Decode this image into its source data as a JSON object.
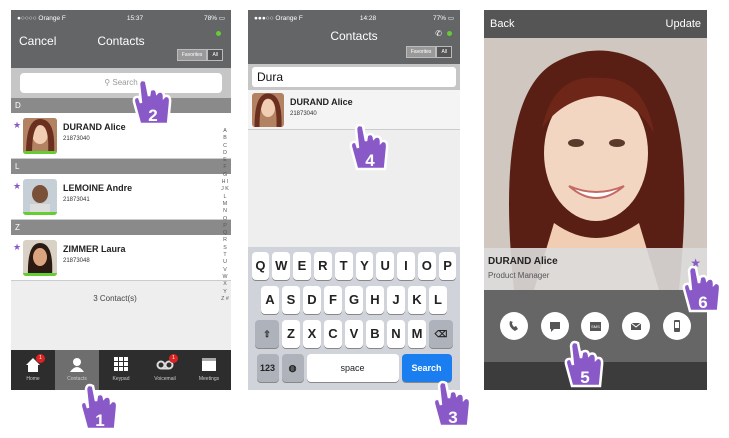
{
  "screen1": {
    "status": {
      "carrier": "●○○○○ Orange F",
      "time": "15:37",
      "battery": "78%"
    },
    "nav": {
      "cancel": "Cancel",
      "title": "Contacts",
      "seg_fav": "Favorites",
      "seg_all": "All"
    },
    "search_placeholder": "Search",
    "sections": [
      {
        "letter": "D",
        "contact": {
          "name": "DURAND Alice",
          "number": "21873040"
        }
      },
      {
        "letter": "L",
        "contact": {
          "name": "LEMOINE Andre",
          "number": "21873041"
        }
      },
      {
        "letter": "Z",
        "contact": {
          "name": "ZIMMER Laura",
          "number": "21873048"
        }
      }
    ],
    "index_letters": "A B C D E F G H I J K L M N O P Q R S T U V W X Y Z #",
    "count": "3 Contact(s)",
    "tabs": [
      {
        "label": "Home",
        "badge": "1"
      },
      {
        "label": "Contacts",
        "badge": ""
      },
      {
        "label": "Keypad",
        "badge": ""
      },
      {
        "label": "Voicemail",
        "badge": "1"
      },
      {
        "label": "Meetings",
        "badge": ""
      }
    ]
  },
  "screen2": {
    "status": {
      "carrier": "●●●○○ Orange F",
      "time": "14:28",
      "battery": "77%"
    },
    "nav": {
      "title": "Contacts",
      "seg_fav": "Favorites",
      "seg_all": "All"
    },
    "search_value": "Dura",
    "result": {
      "name": "DURAND Alice",
      "number": "21873040"
    },
    "keyboard": {
      "row1": [
        "Q",
        "W",
        "E",
        "R",
        "T",
        "Y",
        "U",
        "I",
        "O",
        "P"
      ],
      "row2": [
        "A",
        "S",
        "D",
        "F",
        "G",
        "H",
        "J",
        "K",
        "L"
      ],
      "row3": [
        "Z",
        "X",
        "C",
        "V",
        "B",
        "N",
        "M"
      ],
      "num": "123",
      "space": "space",
      "search": "Search"
    }
  },
  "screen3": {
    "back": "Back",
    "update": "Update",
    "name": "DURAND Alice",
    "title": "Product Manager",
    "actions": [
      "phone-icon",
      "chat-icon",
      "sms-icon",
      "mail-icon",
      "mobile-icon"
    ],
    "sms_label": "SMS"
  },
  "steps": [
    "1",
    "2",
    "3",
    "4",
    "5",
    "6"
  ],
  "colors": {
    "accent": "#8a59c8",
    "online": "#66cc33",
    "search_key": "#1a7ef0",
    "badge": "#dd2222"
  }
}
